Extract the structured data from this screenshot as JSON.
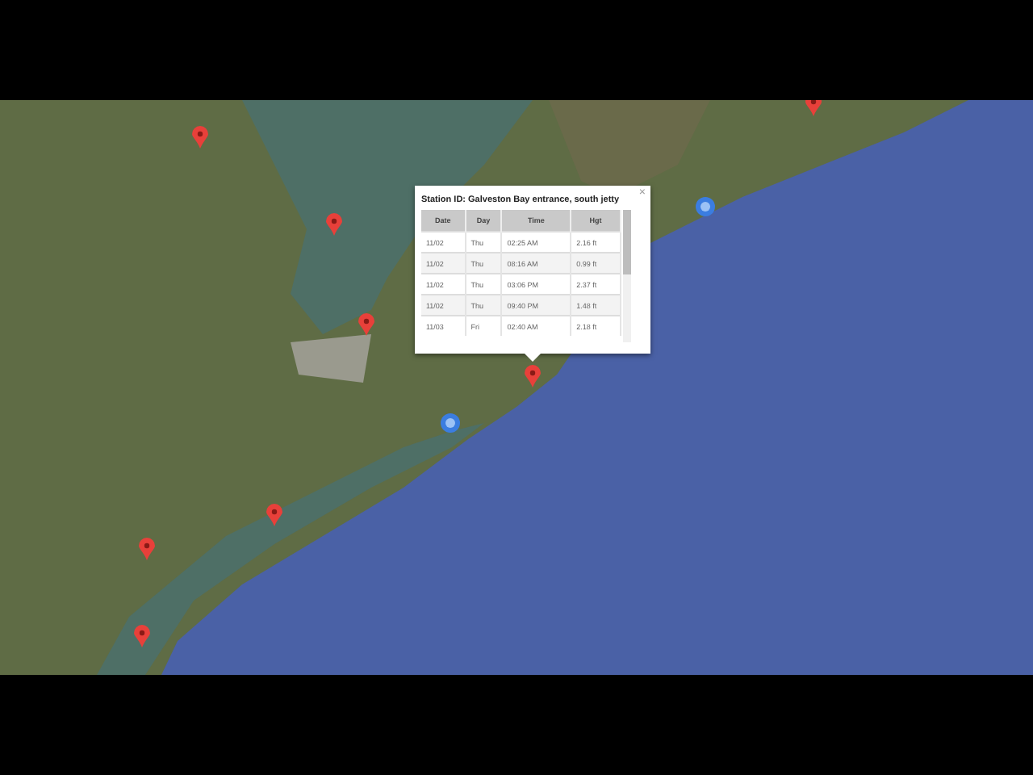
{
  "map": {
    "pins": [
      {
        "kind": "pin"
      },
      {
        "kind": "pin"
      },
      {
        "kind": "pin"
      },
      {
        "kind": "pin"
      },
      {
        "kind": "pin"
      },
      {
        "kind": "pin"
      },
      {
        "kind": "pin"
      },
      {
        "kind": "pin"
      },
      {
        "kind": "cluster"
      },
      {
        "kind": "cluster"
      }
    ]
  },
  "popup": {
    "title": "Station ID: Galveston Bay entrance, south jetty",
    "close": "×",
    "table": {
      "columns": [
        "Date",
        "Day",
        "Time",
        "Hgt"
      ],
      "rows": [
        [
          "11/02",
          "Thu",
          "02:25 AM",
          "2.16 ft"
        ],
        [
          "11/02",
          "Thu",
          "08:16 AM",
          "0.99 ft"
        ],
        [
          "11/02",
          "Thu",
          "03:06 PM",
          "2.37 ft"
        ],
        [
          "11/02",
          "Thu",
          "09:40 PM",
          "1.48 ft"
        ],
        [
          "11/03",
          "Fri",
          "02:40 AM",
          "2.18 ft"
        ]
      ]
    }
  }
}
